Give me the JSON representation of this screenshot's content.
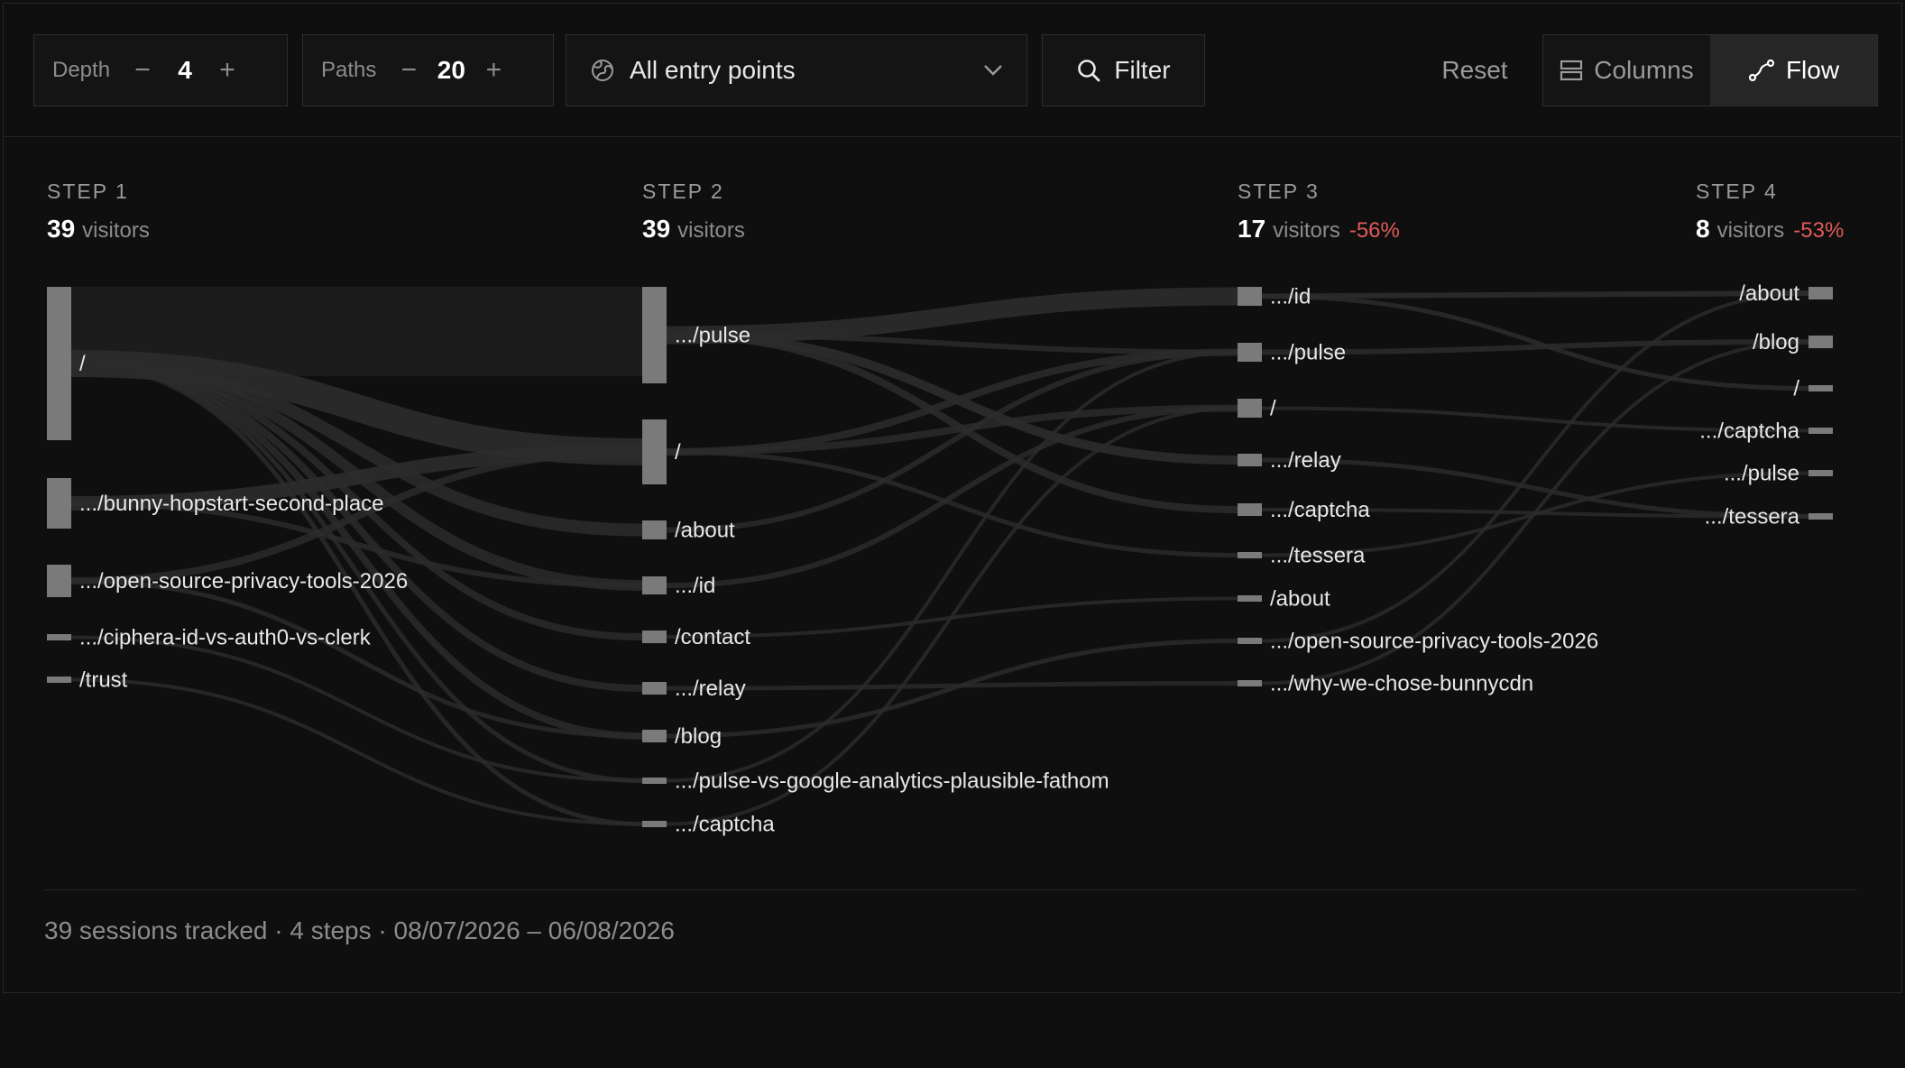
{
  "toolbar": {
    "depth": {
      "label": "Depth",
      "value": "4",
      "minus": "−",
      "plus": "+"
    },
    "paths": {
      "label": "Paths",
      "value": "20",
      "minus": "−",
      "plus": "+"
    },
    "entry_select": {
      "icon": "globe-icon",
      "value": "All entry points",
      "caret": "chevron-down-icon"
    },
    "filter": {
      "icon": "search-icon",
      "label": "Filter"
    },
    "reset_label": "Reset",
    "view": {
      "columns_label": "Columns",
      "flow_label": "Flow",
      "active": "Flow"
    }
  },
  "steps": [
    {
      "title": "STEP 1",
      "count": "39",
      "unit": "visitors",
      "drop": ""
    },
    {
      "title": "STEP 2",
      "count": "39",
      "unit": "visitors",
      "drop": ""
    },
    {
      "title": "STEP 3",
      "count": "17",
      "unit": "visitors",
      "drop": "-56%"
    },
    {
      "title": "STEP 4",
      "count": "8",
      "unit": "visitors",
      "drop": "-53%"
    }
  ],
  "nodes": [
    [
      {
        "label": "/"
      },
      {
        "label": ".../bunny-hopstart-second-place"
      },
      {
        "label": ".../open-source-privacy-tools-2026"
      },
      {
        "label": ".../ciphera-id-vs-auth0-vs-clerk"
      },
      {
        "label": "/trust"
      }
    ],
    [
      {
        "label": ".../pulse"
      },
      {
        "label": "/"
      },
      {
        "label": "/about"
      },
      {
        "label": ".../id"
      },
      {
        "label": "/contact"
      },
      {
        "label": ".../relay"
      },
      {
        "label": "/blog"
      },
      {
        "label": ".../pulse-vs-google-analytics-plausible-fathom"
      },
      {
        "label": ".../captcha"
      }
    ],
    [
      {
        "label": ".../id"
      },
      {
        "label": ".../pulse"
      },
      {
        "label": "/"
      },
      {
        "label": ".../relay"
      },
      {
        "label": ".../captcha"
      },
      {
        "label": ".../tessera"
      },
      {
        "label": "/about"
      },
      {
        "label": ".../open-source-privacy-tools-2026"
      },
      {
        "label": ".../why-we-chose-bunnycdn"
      }
    ],
    [
      {
        "label": "/about"
      },
      {
        "label": "/blog"
      },
      {
        "label": "/"
      },
      {
        "label": ".../captcha"
      },
      {
        "label": ".../pulse"
      },
      {
        "label": ".../tessera"
      }
    ]
  ],
  "footer": "39 sessions tracked · 4 steps · 08/07/2026 – 06/08/2026",
  "colors": {
    "node": "#7a7a7a",
    "link": "#2c2c2c",
    "drop": "#e05a5a",
    "background": "#0f0f0f"
  }
}
